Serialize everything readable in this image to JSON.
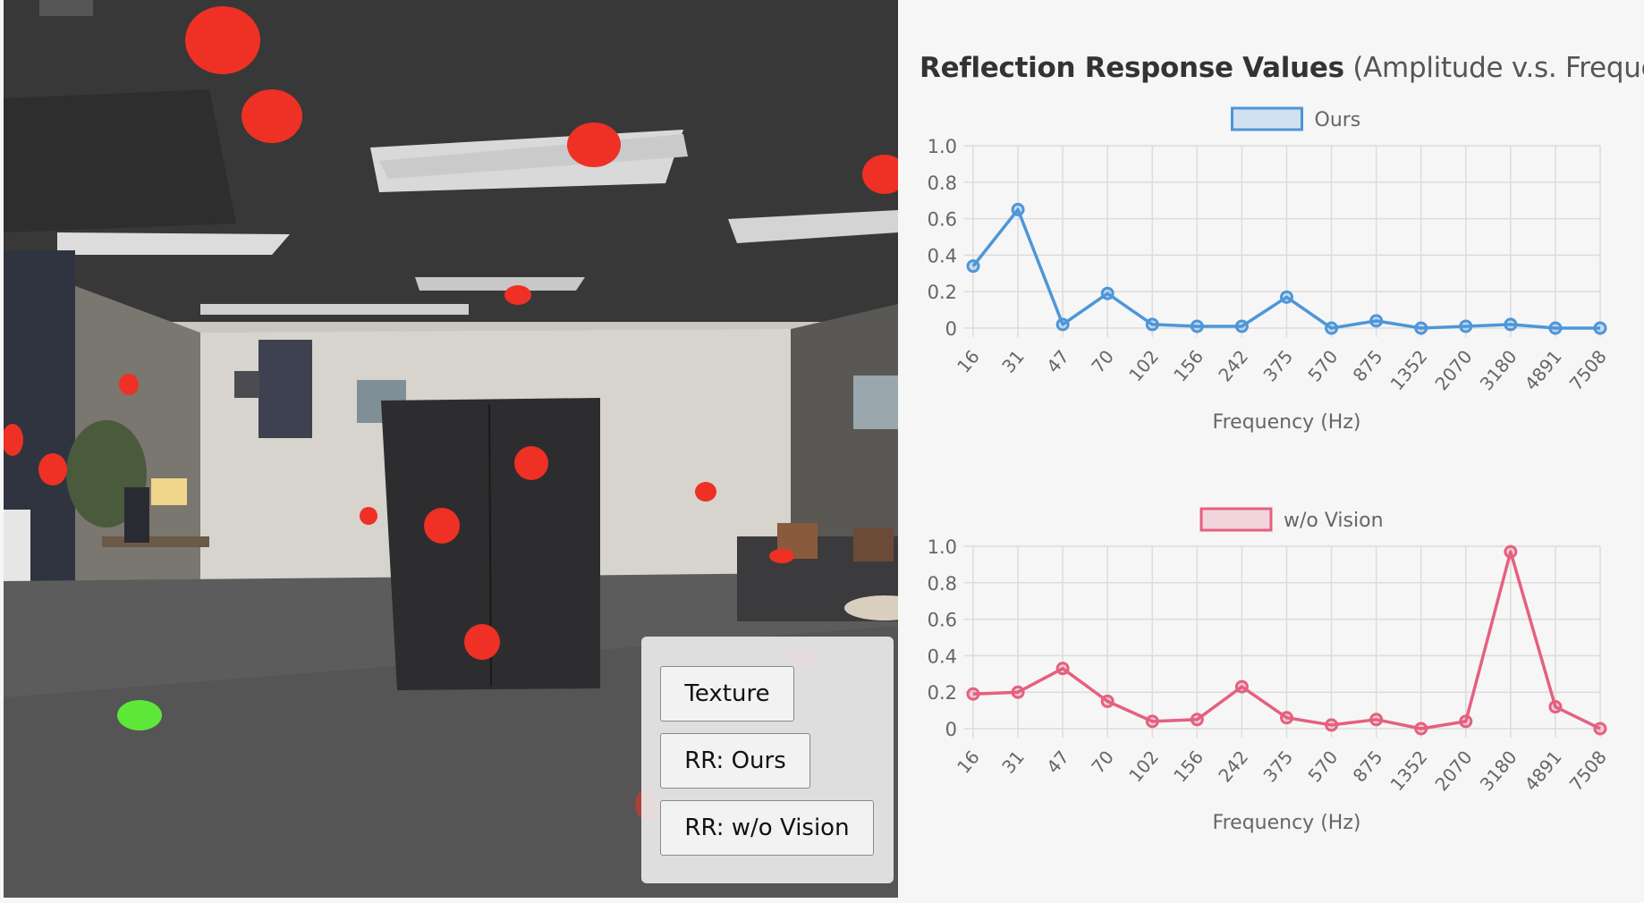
{
  "title_bold": "Reflection Response Values",
  "title_rest": "(Amplitude v.s. Frequency)",
  "controls": {
    "texture_label": "Texture",
    "rr_ours_label": "RR: Ours",
    "rr_wov_label": "RR: w/o Vision"
  },
  "colors": {
    "ours": "#4e96d9",
    "wov": "#e5607f",
    "marker_red": "#ee3124",
    "marker_green": "#5ee83a"
  },
  "chart_data": [
    {
      "type": "line",
      "title": "",
      "xlabel": "Frequency (Hz)",
      "ylabel": "",
      "x": [
        "16",
        "31",
        "47",
        "70",
        "102",
        "156",
        "242",
        "375",
        "570",
        "875",
        "1352",
        "2070",
        "3180",
        "4891",
        "7508"
      ],
      "ylim": [
        0,
        1.0
      ],
      "yticks": [
        "1.0",
        "0.8",
        "0.6",
        "0.4",
        "0.2",
        "0"
      ],
      "legend": "top-center",
      "grid": true,
      "series": [
        {
          "name": "Ours",
          "values": [
            0.34,
            0.65,
            0.02,
            0.19,
            0.02,
            0.01,
            0.01,
            0.17,
            0.0,
            0.04,
            0.0,
            0.01,
            0.02,
            0.0,
            0.0
          ]
        }
      ]
    },
    {
      "type": "line",
      "title": "",
      "xlabel": "Frequency (Hz)",
      "ylabel": "",
      "x": [
        "16",
        "31",
        "47",
        "70",
        "102",
        "156",
        "242",
        "375",
        "570",
        "875",
        "1352",
        "2070",
        "3180",
        "4891",
        "7508"
      ],
      "ylim": [
        0,
        1.0
      ],
      "yticks": [
        "1.0",
        "0.8",
        "0.6",
        "0.4",
        "0.2",
        "0"
      ],
      "legend": "top-center",
      "grid": true,
      "series": [
        {
          "name": "w/o Vision",
          "values": [
            0.19,
            0.2,
            0.33,
            0.15,
            0.04,
            0.05,
            0.23,
            0.06,
            0.02,
            0.05,
            0.0,
            0.04,
            0.97,
            0.12,
            0.0
          ]
        }
      ]
    }
  ]
}
